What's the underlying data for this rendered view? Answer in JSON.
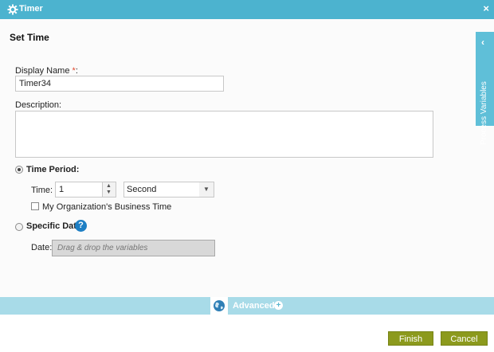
{
  "window": {
    "title": "Timer",
    "close_glyph": "×"
  },
  "form": {
    "heading": "Set Time",
    "display_name": {
      "label": "Display Name",
      "required_mark": "*",
      "colon": ":",
      "value": "Timer34"
    },
    "description": {
      "label": "Description:",
      "value": ""
    },
    "time_period": {
      "label": "Time Period:",
      "selected": true,
      "time_label": "Time:",
      "time_value": "1",
      "unit_selected": "Second",
      "business_time_label": "My Organization's Business Time",
      "business_time_checked": false
    },
    "specific_date": {
      "label": "Specific Date",
      "selected": false,
      "date_label": "Date:",
      "date_placeholder": "Drag & drop the variables"
    }
  },
  "side_panel": {
    "label": "Process Variables"
  },
  "advanced": {
    "label": "Advanced"
  },
  "buttons": {
    "finish": "Finish",
    "cancel": "Cancel"
  },
  "colors": {
    "titlebar": "#4cb3cf",
    "side_tab": "#5fbfd8",
    "advanced_bar": "#a8dbe8",
    "button": "#8c9a1d",
    "required": "#e0492f",
    "help": "#1e7fc4"
  },
  "icons": {
    "titlebar": "gear-icon",
    "close": "close-icon",
    "side_tab": "chevron-left-icon",
    "advanced": "globe-icon",
    "advanced_toggle": "plus-circle-icon",
    "help": "help-icon"
  }
}
